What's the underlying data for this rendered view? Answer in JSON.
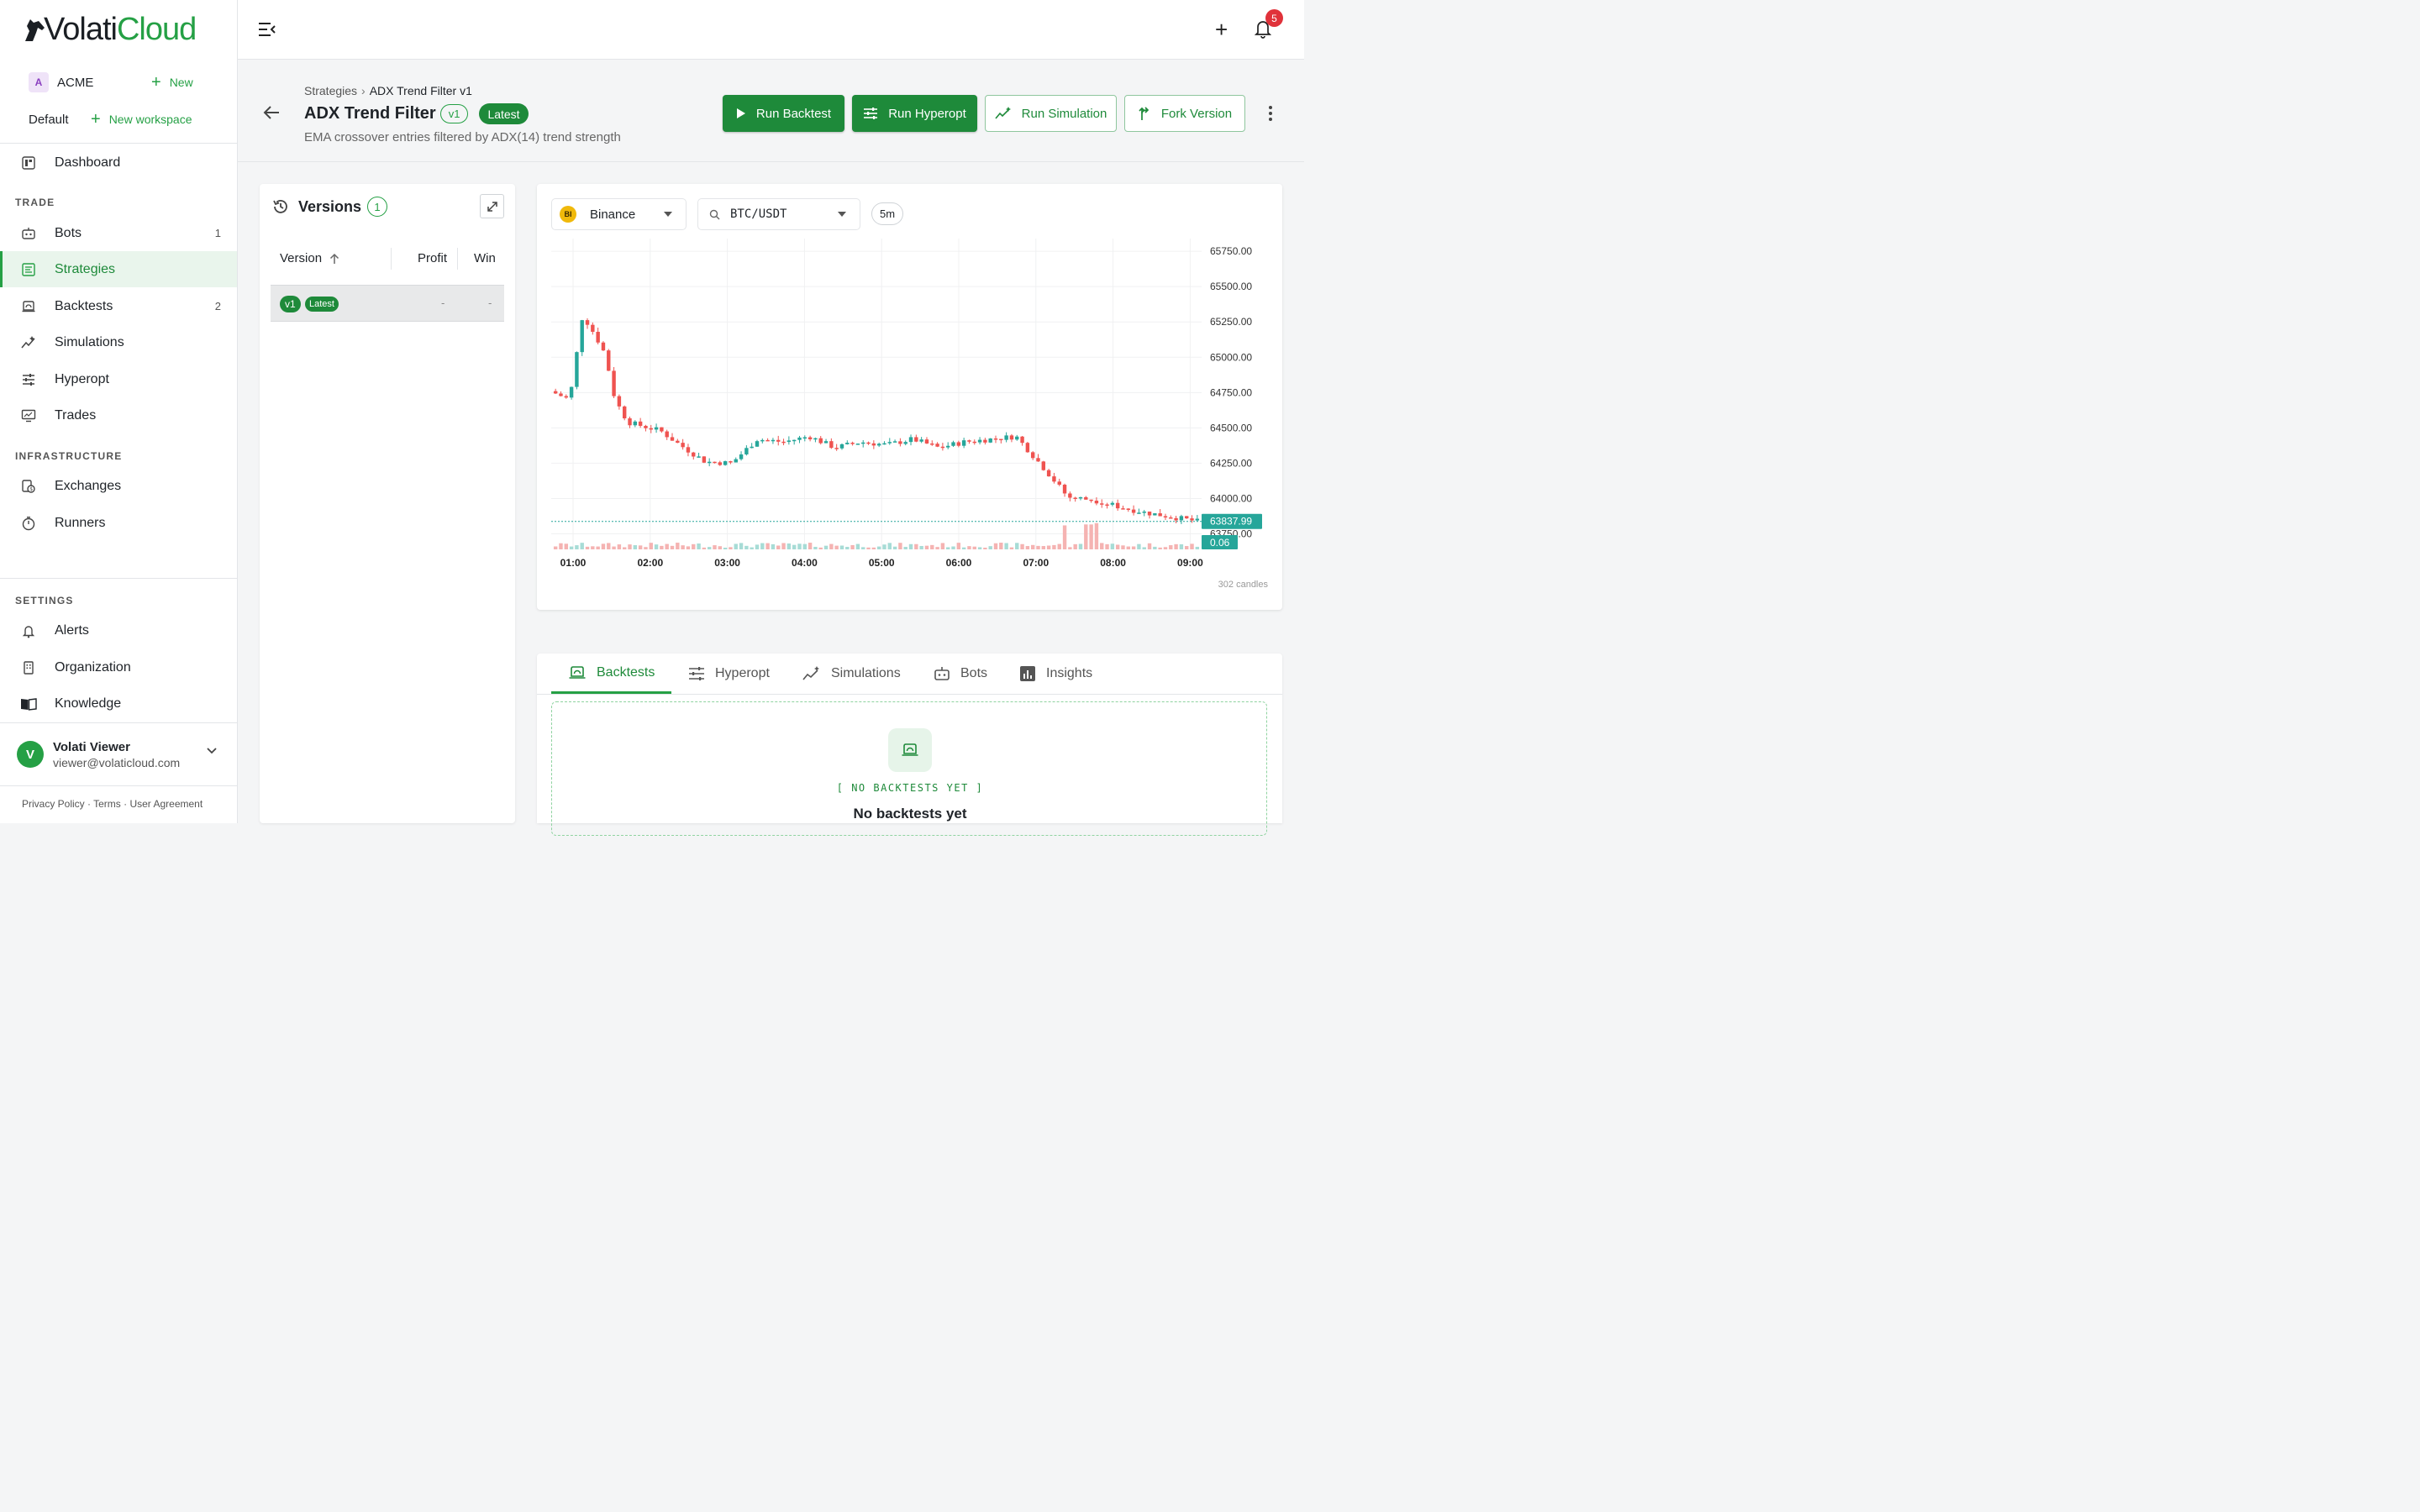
{
  "brand": {
    "name_part1": "Volati",
    "name_part2": "Cloud"
  },
  "org": {
    "avatar_letter": "A",
    "name": "ACME",
    "new_label": "New"
  },
  "workspace": {
    "name": "Default",
    "new_label": "New workspace"
  },
  "nav": {
    "dashboard": "Dashboard",
    "trade_label": "TRADE",
    "bots": {
      "label": "Bots",
      "count": "1"
    },
    "strategies": "Strategies",
    "backtests": {
      "label": "Backtests",
      "count": "2"
    },
    "simulations": "Simulations",
    "hyperopt": "Hyperopt",
    "trades": "Trades",
    "infra_label": "INFRASTRUCTURE",
    "exchanges": "Exchanges",
    "runners": "Runners",
    "settings_label": "SETTINGS",
    "alerts": "Alerts",
    "organization": "Organization",
    "knowledge": "Knowledge"
  },
  "user": {
    "avatar_letter": "V",
    "name": "Volati Viewer",
    "email": "viewer@volaticloud.com"
  },
  "footer": {
    "links": "Privacy Policy · Terms · User Agreement"
  },
  "topbar": {
    "notification_count": "5"
  },
  "header": {
    "breadcrumb_root": "Strategies",
    "breadcrumb_current": "ADX Trend Filter v1",
    "title": "ADX Trend Filter",
    "version_chip": "v1",
    "latest_chip": "Latest",
    "subtitle": "EMA crossover entries filtered by ADX(14) trend strength",
    "buttons": {
      "run_backtest": "Run Backtest",
      "run_hyperopt": "Run Hyperopt",
      "run_simulation": "Run Simulation",
      "fork_version": "Fork Version"
    }
  },
  "versions": {
    "title": "Versions",
    "count": "1",
    "columns": {
      "version": "Version",
      "profit": "Profit",
      "win": "Win"
    },
    "rows": [
      {
        "version": "v1",
        "tag": "Latest",
        "profit": "-",
        "win": "-"
      }
    ]
  },
  "chart_panel": {
    "exchange": {
      "logo": "BI",
      "name": "Binance"
    },
    "pair": "BTC/USDT",
    "timeframe": "5m",
    "candles_label": "302 candles"
  },
  "chart_data": {
    "type": "candlestick",
    "x_labels": [
      "01:00",
      "02:00",
      "03:00",
      "04:00",
      "05:00",
      "06:00",
      "07:00",
      "08:00",
      "09:00"
    ],
    "y_ticks": [
      "65750.00",
      "65500.00",
      "65250.00",
      "65000.00",
      "64750.00",
      "64500.00",
      "64250.00",
      "64000.00",
      "63750.00"
    ],
    "ylim": [
      63640,
      65840
    ],
    "last_price": "63837.99",
    "last_volume": "0.06",
    "price_path": [
      [
        0,
        64760
      ],
      [
        0.03,
        64700
      ],
      [
        0.05,
        65300
      ],
      [
        0.07,
        65150
      ],
      [
        0.085,
        65020
      ],
      [
        0.1,
        64700
      ],
      [
        0.12,
        64540
      ],
      [
        0.17,
        64480
      ],
      [
        0.2,
        64380
      ],
      [
        0.24,
        64260
      ],
      [
        0.28,
        64250
      ],
      [
        0.32,
        64420
      ],
      [
        0.36,
        64400
      ],
      [
        0.4,
        64440
      ],
      [
        0.44,
        64360
      ],
      [
        0.48,
        64400
      ],
      [
        0.52,
        64380
      ],
      [
        0.56,
        64420
      ],
      [
        0.6,
        64360
      ],
      [
        0.64,
        64400
      ],
      [
        0.68,
        64420
      ],
      [
        0.72,
        64440
      ],
      [
        0.76,
        64230
      ],
      [
        0.8,
        64010
      ],
      [
        0.84,
        63990
      ],
      [
        0.88,
        63940
      ],
      [
        0.92,
        63900
      ],
      [
        0.96,
        63870
      ],
      [
        1.0,
        63838
      ]
    ]
  },
  "tabs": {
    "backtests": "Backtests",
    "hyperopt": "Hyperopt",
    "simulations": "Simulations",
    "bots": "Bots",
    "insights": "Insights"
  },
  "empty_state": {
    "code": "[ NO BACKTESTS YET ]",
    "title": "No backtests yet"
  },
  "colors": {
    "accent": "#25a045",
    "accent_dark": "#1e8a3a",
    "up": "#26a69a",
    "down": "#ef5350",
    "badge": "#e0323a"
  }
}
